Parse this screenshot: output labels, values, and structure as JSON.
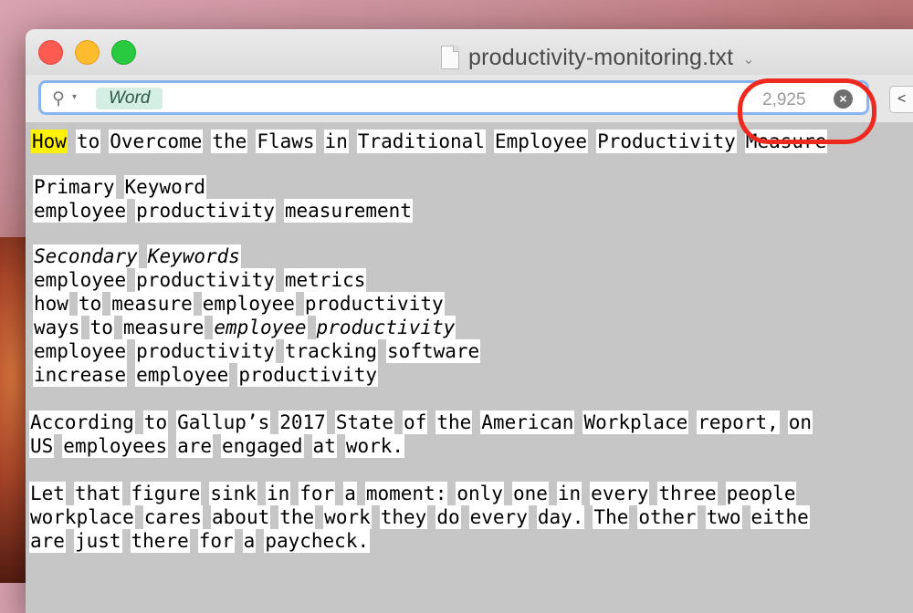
{
  "window": {
    "title": "productivity-monitoring.txt"
  },
  "find": {
    "token": "Word",
    "match_count": "2,925",
    "clear_label": "⊗",
    "prev_label": "<"
  },
  "doc": {
    "title_words": [
      "How",
      "to",
      "Overcome",
      "the",
      "Flaws",
      "in",
      "Traditional",
      "Employee",
      "Productivity",
      "Measure"
    ],
    "primary_heading": [
      "Primary",
      "Keyword"
    ],
    "primary_kw": [
      "employee",
      "productivity",
      "measurement"
    ],
    "secondary_heading": [
      "Secondary",
      "Keywords"
    ],
    "kw1": [
      "employee",
      "productivity",
      "metrics"
    ],
    "kw2": [
      "how",
      "to",
      "measure",
      "employee",
      "productivity"
    ],
    "kw3": [
      "ways",
      "to",
      "measure",
      "employee",
      "productivity"
    ],
    "kw4": [
      "employee",
      "productivity",
      "tracking",
      "software"
    ],
    "kw5": [
      "increase",
      "employee",
      "productivity"
    ],
    "p1a": [
      "According",
      "to",
      "Gallup’s",
      "2017",
      "State",
      "of",
      "the",
      "American",
      "Workplace",
      "report,",
      "on"
    ],
    "p1b": [
      "US",
      "employees",
      "are",
      "engaged",
      "at",
      "work."
    ],
    "p2a": [
      "Let",
      "that",
      "figure",
      "sink",
      "in",
      "for",
      "a",
      "moment:",
      "only",
      "one",
      "in",
      "every",
      "three",
      "people"
    ],
    "p2b": [
      "workplace",
      "cares",
      "about",
      "the",
      "work",
      "they",
      "do",
      "every",
      "day.",
      "The",
      "other",
      "two",
      "eithe"
    ],
    "p2c": [
      "are",
      "just",
      "there",
      "for",
      "a",
      "paycheck."
    ]
  }
}
